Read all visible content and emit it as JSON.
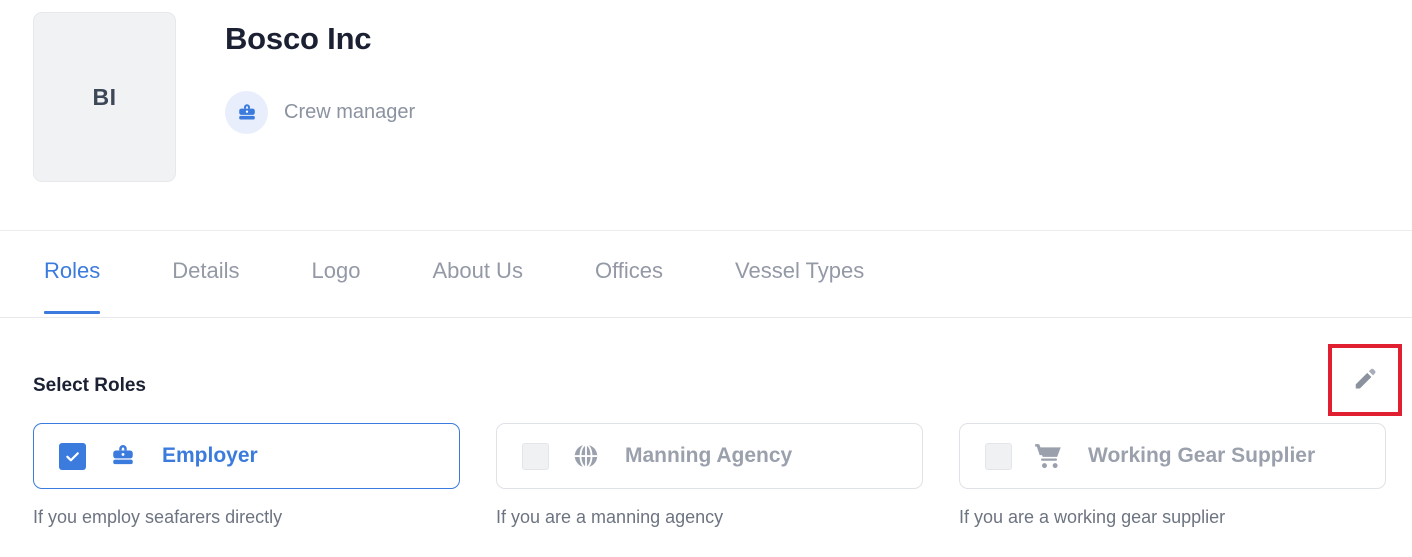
{
  "header": {
    "avatar_initials": "BI",
    "company_name": "Bosco Inc",
    "role_label": "Crew manager",
    "role_icon": "briefcase-icon",
    "accent_color": "#3b7bdd",
    "role_icon_bg": "#e8eefc"
  },
  "tabs": [
    {
      "label": "Roles",
      "active": true
    },
    {
      "label": "Details",
      "active": false
    },
    {
      "label": "Logo",
      "active": false
    },
    {
      "label": "About Us",
      "active": false
    },
    {
      "label": "Offices",
      "active": false
    },
    {
      "label": "Vessel Types",
      "active": false
    }
  ],
  "main": {
    "section_title": "Select Roles",
    "edit_button": {
      "icon": "pencil-icon",
      "highlight_color": "#e02030"
    },
    "roles": [
      {
        "label": "Employer",
        "description": "If you employ seafarers directly",
        "icon": "briefcase-icon",
        "checked": true
      },
      {
        "label": "Manning Agency",
        "description": "If you are a manning agency",
        "icon": "globe-icon",
        "checked": false
      },
      {
        "label": "Working Gear Supplier",
        "description": "If you are a working gear supplier",
        "icon": "shopping-cart-icon",
        "checked": false
      }
    ]
  }
}
